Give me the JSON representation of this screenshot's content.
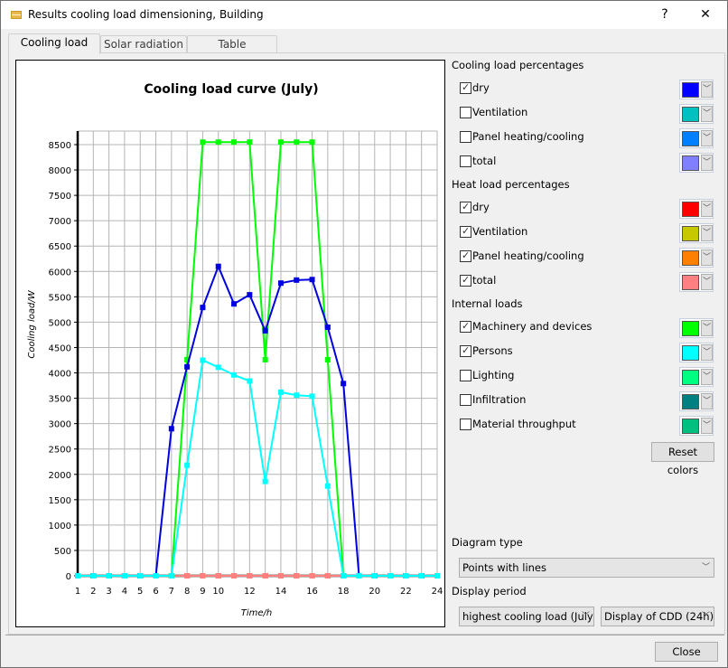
{
  "window": {
    "title": "Results cooling load dimensioning, Building",
    "help_label": "?",
    "close_label": "✕"
  },
  "tabs": [
    {
      "label": "Cooling load",
      "active": true
    },
    {
      "label": "Solar radiation",
      "active": false
    },
    {
      "label": "Table",
      "active": false
    }
  ],
  "chart_data": {
    "type": "line",
    "title": "Cooling load curve (July)",
    "xlabel": "Time/h",
    "ylabel": "Cooling load/W",
    "x": [
      1,
      2,
      3,
      4,
      5,
      6,
      7,
      8,
      9,
      10,
      11,
      12,
      13,
      14,
      15,
      16,
      17,
      18,
      19,
      20,
      21,
      22,
      23,
      24
    ],
    "x_tick_labels": [
      "1",
      "2",
      "3",
      "4",
      "5",
      "6",
      "7",
      "8",
      "9",
      "10",
      "12",
      "14",
      "16",
      "18",
      "20",
      "22",
      "24"
    ],
    "y_ticks": [
      0,
      500,
      1000,
      1500,
      2000,
      2500,
      3000,
      3500,
      4000,
      4500,
      5000,
      5500,
      6000,
      6500,
      7000,
      7500,
      8000,
      8500
    ],
    "ylim": [
      0,
      8750
    ],
    "xlim": [
      1,
      24
    ],
    "grid": true,
    "series": [
      {
        "name": "Heat load dry",
        "color": "#ff0000",
        "values": [
          0,
          0,
          0,
          0,
          0,
          0,
          0,
          0,
          0,
          0,
          0,
          0,
          0,
          0,
          0,
          0,
          0,
          0,
          0,
          0,
          0,
          0,
          0,
          0
        ]
      },
      {
        "name": "Heat load Ventilation",
        "color": "#c8c800",
        "values": [
          0,
          0,
          0,
          0,
          0,
          0,
          0,
          0,
          0,
          0,
          0,
          0,
          0,
          0,
          0,
          0,
          0,
          0,
          0,
          0,
          0,
          0,
          0,
          0
        ]
      },
      {
        "name": "Heat load Panel heating/cooling",
        "color": "#ff8000",
        "values": [
          0,
          0,
          0,
          0,
          0,
          0,
          0,
          0,
          0,
          0,
          0,
          0,
          0,
          0,
          0,
          0,
          0,
          0,
          0,
          0,
          0,
          0,
          0,
          0
        ]
      },
      {
        "name": "Heat load total",
        "color": "#ff8080",
        "values": [
          0,
          0,
          0,
          0,
          0,
          0,
          0,
          0,
          0,
          0,
          0,
          0,
          0,
          0,
          0,
          0,
          0,
          0,
          0,
          0,
          0,
          0,
          0,
          0
        ]
      },
      {
        "name": "Machinery and devices",
        "color": "#00ff00",
        "values": [
          0,
          0,
          0,
          0,
          0,
          0,
          0,
          4260,
          8550,
          8550,
          8550,
          8550,
          4260,
          8550,
          8550,
          8550,
          4260,
          0,
          0,
          0,
          0,
          0,
          0,
          0
        ]
      },
      {
        "name": "Cooling load dry",
        "color": "#0000e0",
        "values": [
          0,
          0,
          0,
          0,
          0,
          0,
          2900,
          4120,
          5290,
          6100,
          5360,
          5540,
          4830,
          5770,
          5830,
          5840,
          4900,
          3790,
          0,
          0,
          0,
          0,
          0,
          0
        ]
      },
      {
        "name": "Persons",
        "color": "#00ffff",
        "values": [
          0,
          0,
          0,
          0,
          0,
          0,
          0,
          2180,
          4250,
          4110,
          3960,
          3840,
          1860,
          3620,
          3560,
          3540,
          1770,
          0,
          0,
          0,
          0,
          0,
          0,
          0
        ]
      }
    ]
  },
  "panel": {
    "cooling_title": "Cooling load percentages",
    "cooling_items": [
      {
        "label": "dry",
        "checked": true,
        "color": "#0000ff"
      },
      {
        "label": "Ventilation",
        "checked": false,
        "color": "#00c0c0"
      },
      {
        "label": "Panel heating/cooling",
        "checked": false,
        "color": "#0080ff"
      },
      {
        "label": "total",
        "checked": false,
        "color": "#8080ff"
      }
    ],
    "heat_title": "Heat load percentages",
    "heat_items": [
      {
        "label": "dry",
        "checked": true,
        "color": "#ff0000"
      },
      {
        "label": "Ventilation",
        "checked": true,
        "color": "#c8c800"
      },
      {
        "label": "Panel heating/cooling",
        "checked": true,
        "color": "#ff8000"
      },
      {
        "label": "total",
        "checked": true,
        "color": "#ff8080"
      }
    ],
    "internal_title": "Internal loads",
    "internal_items": [
      {
        "label": "Machinery and devices",
        "checked": true,
        "color": "#00ff00"
      },
      {
        "label": "Persons",
        "checked": true,
        "color": "#00ffff"
      },
      {
        "label": "Lighting",
        "checked": false,
        "color": "#00ff80"
      },
      {
        "label": "Infiltration",
        "checked": false,
        "color": "#008080"
      },
      {
        "label": "Material throughput",
        "checked": false,
        "color": "#00c080"
      }
    ],
    "reset_colors_label": "Reset colors",
    "diagram_type_label": "Diagram type",
    "diagram_type_value": "Points with lines",
    "display_period_label": "Display period",
    "period_value": "highest cooling load (July)",
    "period_mode_value": "Display of CDD (24h)",
    "check_glyph": "✓",
    "arrow_glyph": "﹀"
  },
  "footer": {
    "close_label": "Close"
  }
}
